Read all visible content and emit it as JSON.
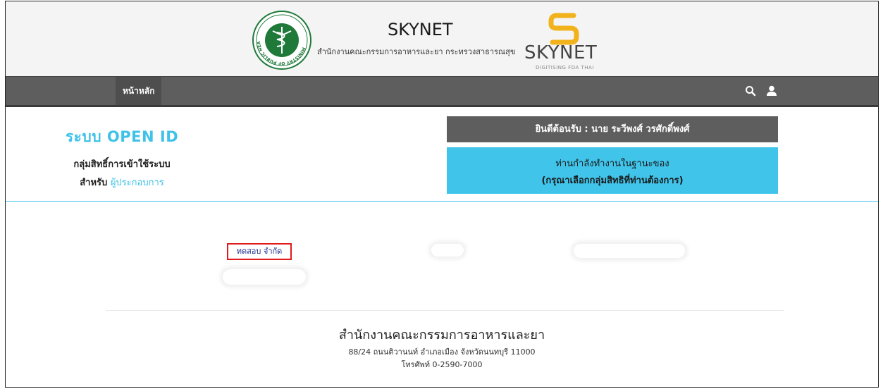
{
  "header": {
    "title": "SKYNET",
    "subtitle": "สำนักงานคณะกรรมการอาหารและยา กระทรวงสาธารณสุข",
    "logo_word": "SKYNET",
    "logo_tagline": "DIGITISING FDA THAI",
    "seal_icon": "ministry-of-public-health-seal",
    "seal_text": "MINISTRY OF PUBLIC HEALTH"
  },
  "navbar": {
    "home_label": "หน้าหลัก",
    "icons": [
      "search-icon",
      "user-icon"
    ]
  },
  "openid": {
    "title": "ระบบ OPEN ID",
    "subtitle": "กลุ่มสิทธิ์การเข้าใช้ระบบ",
    "for_label": "สำหรับ",
    "role_link": "ผู้ประกอบการ"
  },
  "welcome": {
    "text": "ยินดีต้อนรับ : นาย ระวีพงศ์ วรศักดิ์พงศ์"
  },
  "status": {
    "line1": "ท่านกำลังทำงานในฐานะของ",
    "line2": "(กรุณาเลือกกลุ่มสิทธิที่ท่านต้องการ)"
  },
  "company": {
    "name": "ทดสอบ จำกัด"
  },
  "footer": {
    "org": "สำนักงานคณะกรรมการอาหารและยา",
    "address": "88/24 ถนนติวานนท์ อำเภอเมือง จังหวัดนนทบุรี 11000",
    "phone": "โทรศัพท์ 0-2590-7000"
  },
  "colors": {
    "accent_cyan": "#40c4ea",
    "navbar_gray": "#5e5e5e",
    "highlight_red": "#e01b1b",
    "seal_green": "#1f7a3a",
    "logo_gold": "#f2b21b"
  }
}
